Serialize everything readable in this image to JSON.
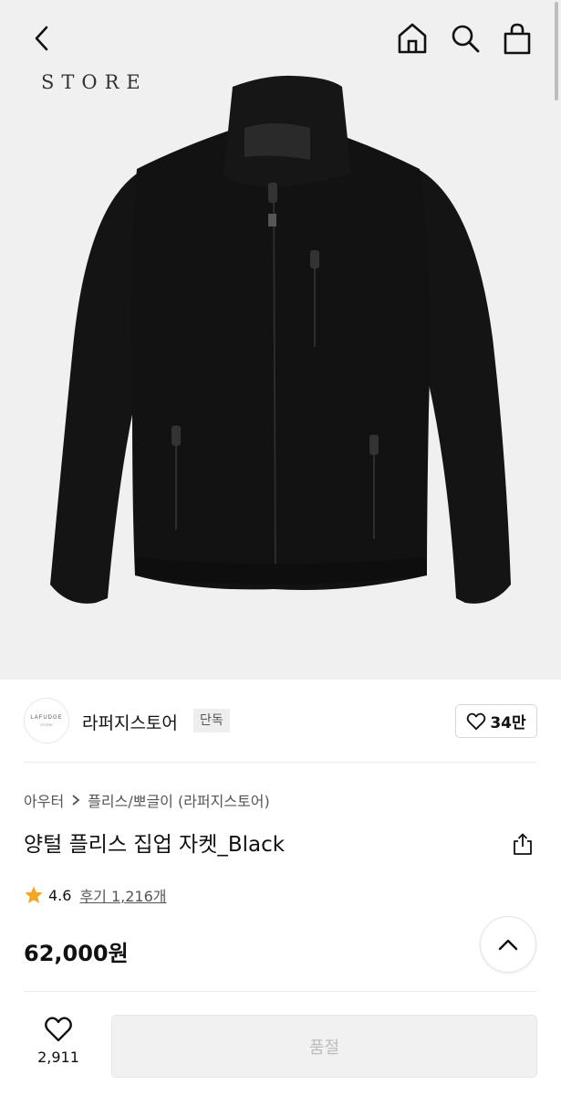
{
  "header": {
    "back_icon": "chevron-left-icon",
    "home_icon": "home-icon",
    "search_icon": "search-icon",
    "cart_icon": "shopping-bag-icon",
    "store_watermark": "STORE"
  },
  "product_image": {
    "subject": "jacket-image"
  },
  "seller": {
    "logo_text": "LAFUDGE",
    "logo_subtext": "STORE",
    "name": "라퍼지스토어",
    "badge": "단독",
    "like_icon": "heart-icon",
    "like_count": "34만"
  },
  "breadcrumb": {
    "items": [
      "아우터",
      "플리스/뽀글이 (라퍼지스토어)"
    ]
  },
  "product": {
    "title": "양털 플리스 집업 자켓_Black",
    "share_icon": "share-icon",
    "rating": "4.6",
    "review_label": "후기 1,216개",
    "price": "62,000원"
  },
  "bottom_bar": {
    "wish_icon": "heart-outline-icon",
    "wish_count": "2,911",
    "buy_button_label": "품절"
  },
  "colors": {
    "image_bg": "#f0f0f0",
    "jacket": "#121212",
    "star": "#f5a623",
    "disabled_btn": "#f1f1f1"
  }
}
